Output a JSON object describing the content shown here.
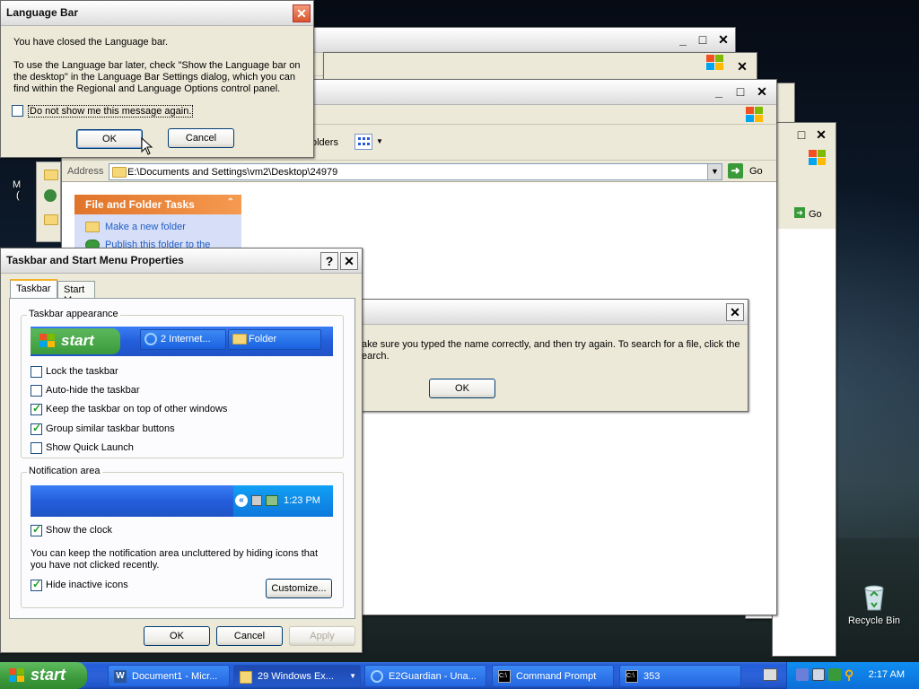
{
  "desktop": {
    "recycle_bin_label": "Recycle Bin",
    "left_fragment_1": "M",
    "left_fragment_2": "("
  },
  "explorer_front": {
    "address_label": "Address",
    "address_value": "E:\\Documents and Settings\\vm2\\Desktop\\24979",
    "go_label": "Go",
    "folders_fragment": "olders",
    "file_folder_tasks_title": "File and Folder Tasks",
    "tasks": [
      "Make a new folder",
      "Publish this folder to the"
    ]
  },
  "explorer_back": {
    "go_label": "Go"
  },
  "error_dialog": {
    "message_line1": "ake sure you typed the name correctly, and then try again. To search for a file, click the",
    "message_line2": "earch.",
    "ok_label": "OK"
  },
  "language_bar_dialog": {
    "title": "Language Bar",
    "message1": "You have closed the Language bar.",
    "message2": "To use the Language bar later, check \"Show the Language bar on the desktop\" in the Language Bar Settings dialog, which you can find within the Regional and Language Options control panel.",
    "dont_show_label": "Do not show me this message again.",
    "ok_label": "OK",
    "cancel_label": "Cancel"
  },
  "taskbar_properties": {
    "title": "Taskbar and Start Menu Properties",
    "help_label": "?",
    "tabs": [
      "Taskbar",
      "Start Menu"
    ],
    "appearance_group": "Taskbar appearance",
    "preview_start": "start",
    "preview_buttons": [
      "2 Internet...",
      "Folder"
    ],
    "options": [
      {
        "label": "Lock the taskbar",
        "checked": false
      },
      {
        "label": "Auto-hide the taskbar",
        "checked": false
      },
      {
        "label": "Keep the taskbar on top of other windows",
        "checked": true
      },
      {
        "label": "Group similar taskbar buttons",
        "checked": true
      },
      {
        "label": "Show Quick Launch",
        "checked": false
      }
    ],
    "notification_group": "Notification area",
    "preview_clock": "1:23 PM",
    "show_clock_label": "Show the clock",
    "show_clock_checked": true,
    "hint_text": "You can keep the notification area uncluttered by hiding icons that you have not clicked recently.",
    "hide_inactive_label": "Hide inactive icons",
    "hide_inactive_checked": true,
    "customize_label": "Customize...",
    "ok_label": "OK",
    "cancel_label": "Cancel",
    "apply_label": "Apply"
  },
  "taskbar": {
    "start_label": "start",
    "buttons": [
      {
        "label": "Document1 - Micr..."
      },
      {
        "label": "29 Windows Ex..."
      },
      {
        "label": "E2Guardian - Una..."
      },
      {
        "label": "Command Prompt"
      },
      {
        "label": "353"
      }
    ],
    "clock": "2:17 AM"
  },
  "colors": {
    "xp_blue": "#245edb",
    "start_green": "#3c9a3c",
    "task_orange": "#e0742a"
  }
}
